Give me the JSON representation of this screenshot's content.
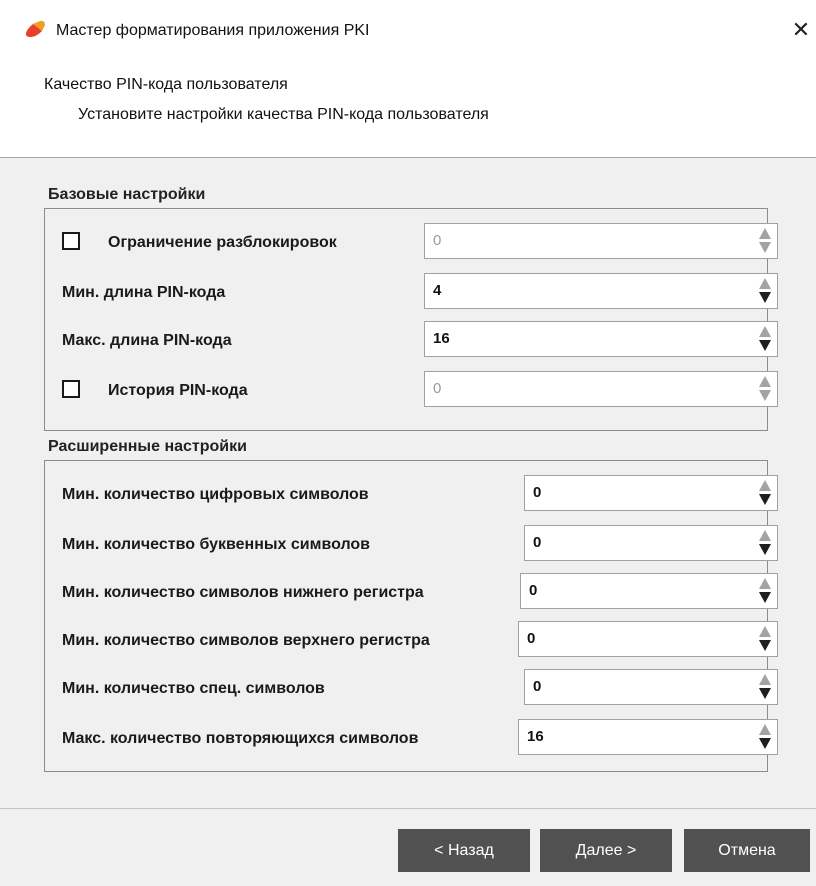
{
  "window": {
    "title": "Мастер форматирования приложения PKI",
    "close_glyph": "✕",
    "icon": "pki-app-icon"
  },
  "header": {
    "title": "Качество PIN-кода пользователя",
    "subtitle": "Установите настройки качества PIN-кода пользователя"
  },
  "basic": {
    "title": "Базовые настройки",
    "rows": [
      {
        "label": "Ограничение разблокировок",
        "value": "0",
        "checkbox": true,
        "checked": false,
        "enabled": false
      },
      {
        "label": "Мин. длина PIN-кода",
        "value": "4",
        "enabled": true
      },
      {
        "label": "Макс. длина PIN-кода",
        "value": "16",
        "enabled": true
      },
      {
        "label": "История PIN-кода",
        "value": "0",
        "checkbox": true,
        "checked": false,
        "enabled": false
      }
    ]
  },
  "advanced": {
    "title": "Расширенные настройки",
    "rows": [
      {
        "label": "Мин. количество цифровых символов",
        "value": "0"
      },
      {
        "label": "Мин. количество буквенных символов",
        "value": "0"
      },
      {
        "label": "Мин. количество символов нижнего регистра",
        "value": "0"
      },
      {
        "label": "Мин. количество символов верхнего регистра",
        "value": "0"
      },
      {
        "label": "Мин. количество спец. символов",
        "value": "0"
      },
      {
        "label": "Макс. количество повторяющихся символов",
        "value": "16"
      }
    ]
  },
  "buttons": {
    "back": "< Назад",
    "next": "Далее >",
    "cancel": "Отмена"
  },
  "colors": {
    "button_bg": "#515151",
    "panel_bg": "#f0f0f0",
    "icon_accent": "#e8402a"
  }
}
